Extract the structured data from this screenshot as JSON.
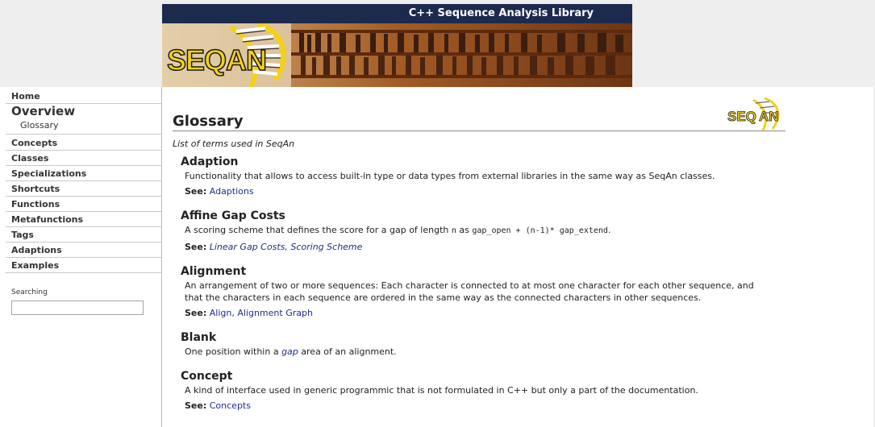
{
  "banner": {
    "title": "C++ Sequence Analysis Library",
    "logo_text": "SEQAN"
  },
  "nav": {
    "home": "Home",
    "overview": "Overview",
    "glossary": "Glossary",
    "items": [
      "Concepts",
      "Classes",
      "Specializations",
      "Shortcuts",
      "Functions",
      "Metafunctions",
      "Tags",
      "Adaptions",
      "Examples"
    ]
  },
  "search": {
    "label": "Searching",
    "value": ""
  },
  "page": {
    "title": "Glossary",
    "subtitle": "List of terms used in SeqAn",
    "logo_text": "SEQAN"
  },
  "see_label": "See:",
  "entries": [
    {
      "term": "Adaption",
      "desc": "Functionality that allows to access built-in type or data types from external libraries in the same way as SeqAn classes.",
      "see": "Adaptions"
    },
    {
      "term": "Affine Gap Costs",
      "desc_pre": "A scoring scheme that defines the score for a gap of length ",
      "desc_n": "n",
      "desc_mid": " as ",
      "desc_formula": "gap_open + (n-1)* gap_extend",
      "desc_end": ".",
      "see_1": "Linear Gap Costs",
      "see_sep": ",",
      "see_2": "Scoring Scheme"
    },
    {
      "term": "Alignment",
      "desc_line1": "An arrangement of two or more sequences: Each character is connected to at most one character for each other sequence, and",
      "desc_line2": "that the characters in each sequence are ordered in the same way as the connected characters in other sequences.",
      "see_1": "Align",
      "see_sep": ",",
      "see_2": "Alignment Graph"
    },
    {
      "term": "Blank",
      "desc_pre": "One position within a ",
      "desc_link": "gap",
      "desc_end": " area of an alignment."
    },
    {
      "term": "Concept",
      "desc": "A kind of interface used in generic programmic that is not formulated in C++ but only a part of the documentation.",
      "see": "Concepts"
    }
  ],
  "colors": {
    "banner_bar": "#1c2a4e",
    "link": "#1f2f86",
    "logo_yellow": "#f3d11a"
  }
}
